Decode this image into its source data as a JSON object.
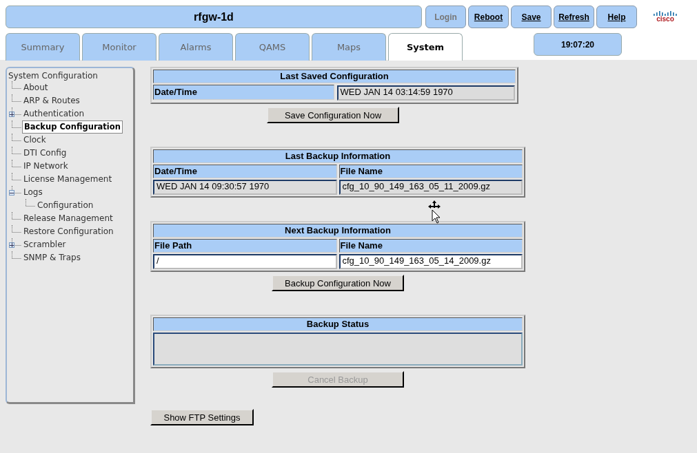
{
  "header": {
    "title": "rfgw-1d",
    "buttons": [
      {
        "label": "Login",
        "disabled": true
      },
      {
        "label": "Reboot",
        "disabled": false
      },
      {
        "label": "Save",
        "disabled": false
      },
      {
        "label": "Refresh",
        "disabled": false
      },
      {
        "label": "Help",
        "disabled": false
      }
    ],
    "logo": "cisco"
  },
  "tabs": [
    {
      "label": "Summary",
      "selected": false
    },
    {
      "label": "Monitor",
      "selected": false
    },
    {
      "label": "Alarms",
      "selected": false
    },
    {
      "label": "QAMS",
      "selected": false
    },
    {
      "label": "Maps",
      "selected": false
    },
    {
      "label": "System",
      "selected": true
    }
  ],
  "clock": "19:07:20",
  "sidebar": {
    "title": "System Configuration",
    "items": [
      {
        "label": "About",
        "selected": false
      },
      {
        "label": "ARP & Routes",
        "selected": false
      },
      {
        "label": "Authentication",
        "selected": false,
        "expanded": false
      },
      {
        "label": "Backup Configuration",
        "selected": true
      },
      {
        "label": "Clock",
        "selected": false
      },
      {
        "label": "DTI Config",
        "selected": false
      },
      {
        "label": "IP Network",
        "selected": false
      },
      {
        "label": "License Management",
        "selected": false
      },
      {
        "label": "Logs",
        "selected": false,
        "expanded": true,
        "children": [
          {
            "label": "Configuration",
            "selected": false
          }
        ]
      },
      {
        "label": "Release Management",
        "selected": false
      },
      {
        "label": "Restore Configuration",
        "selected": false
      },
      {
        "label": "Scrambler",
        "selected": false,
        "expanded": false
      },
      {
        "label": "SNMP & Traps",
        "selected": false
      }
    ]
  },
  "sections": [
    {
      "kind": "pair",
      "title": "Last Saved Configuration",
      "label": "Date/Time",
      "value": {
        "text": "WED JAN 14 03:14:59 1970",
        "readonly": true
      },
      "button": {
        "label": "Save Configuration Now",
        "disabled": false
      }
    },
    {
      "kind": "grid",
      "title": "Last Backup Information",
      "columns": [
        "Date/Time",
        "File Name"
      ],
      "values": [
        {
          "text": "WED JAN 14 09:30:57 1970",
          "readonly": true
        },
        {
          "text": "cfg_10_90_149_163_05_11_2009.gz",
          "readonly": true
        }
      ]
    },
    {
      "kind": "grid",
      "title": "Next Backup Information",
      "columns": [
        "File Path",
        "File Name"
      ],
      "values": [
        {
          "text": "/",
          "readonly": false
        },
        {
          "text": "cfg_10_90_149_163_05_14_2009.gz",
          "readonly": false
        }
      ],
      "button": {
        "label": "Backup Configuration Now",
        "disabled": false
      }
    },
    {
      "kind": "status",
      "title": "Backup Status",
      "button": {
        "label": "Cancel Backup",
        "disabled": true
      }
    }
  ],
  "footer_button": {
    "label": "Show FTP Settings",
    "disabled": false
  }
}
